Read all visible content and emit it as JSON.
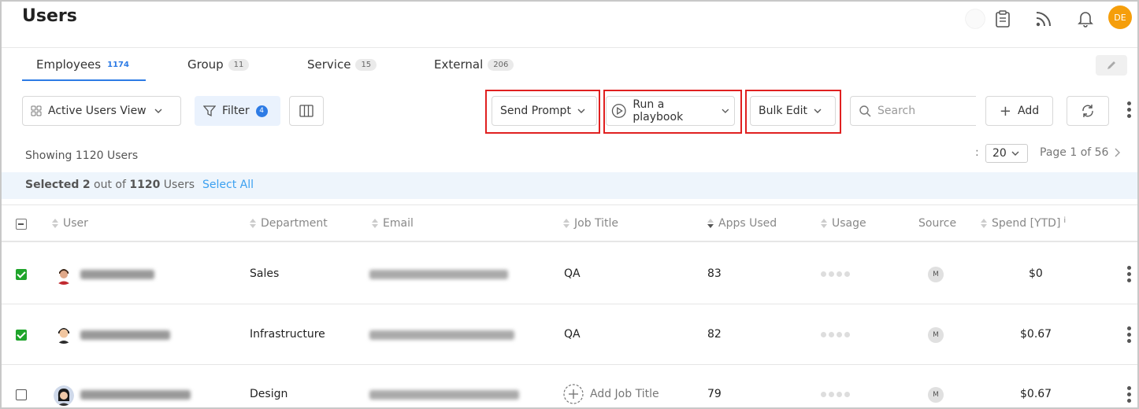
{
  "page": {
    "title": "Users"
  },
  "header": {
    "avatar_initials": "DE",
    "colors": {
      "avatar": "#f59e0b",
      "accent": "#2d7be5",
      "highlight": "#e02020"
    }
  },
  "tabs": [
    {
      "label": "Employees",
      "count": "1174",
      "active": true
    },
    {
      "label": "Group",
      "count": "11"
    },
    {
      "label": "Service",
      "count": "15"
    },
    {
      "label": "External",
      "count": "206"
    }
  ],
  "toolbar": {
    "view_label": "Active Users View",
    "filter_label": "Filter",
    "filter_count": "4",
    "send_prompt_label": "Send Prompt",
    "playbook_label": "Run a playbook",
    "bulk_edit_label": "Bulk Edit",
    "search_placeholder": "Search",
    "add_label": "Add"
  },
  "summary": {
    "showing": "Showing 1120 Users",
    "per_page_sep": ":",
    "per_page": "20",
    "page_info": "Page 1 of 56"
  },
  "selection": {
    "prefix": "Selected",
    "count": "2",
    "middle": "out of",
    "total": "1120",
    "suffix": "Users",
    "select_all": "Select All"
  },
  "table": {
    "columns": {
      "user": "User",
      "department": "Department",
      "email": "Email",
      "job_title": "Job Title",
      "apps_used": "Apps Used",
      "usage": "Usage",
      "source": "Source",
      "spend": "Spend [YTD]",
      "spend_info": "i"
    },
    "rows": [
      {
        "checked": true,
        "department": "Sales",
        "job_title": "QA",
        "apps_used": "83",
        "source": "M",
        "spend": "$0"
      },
      {
        "checked": true,
        "department": "Infrastructure",
        "job_title": "QA",
        "apps_used": "82",
        "source": "M",
        "spend": "$0.67"
      },
      {
        "checked": false,
        "department": "Design",
        "job_title": "Add Job Title",
        "apps_used": "79",
        "source": "M",
        "spend": "$0.67"
      }
    ]
  }
}
